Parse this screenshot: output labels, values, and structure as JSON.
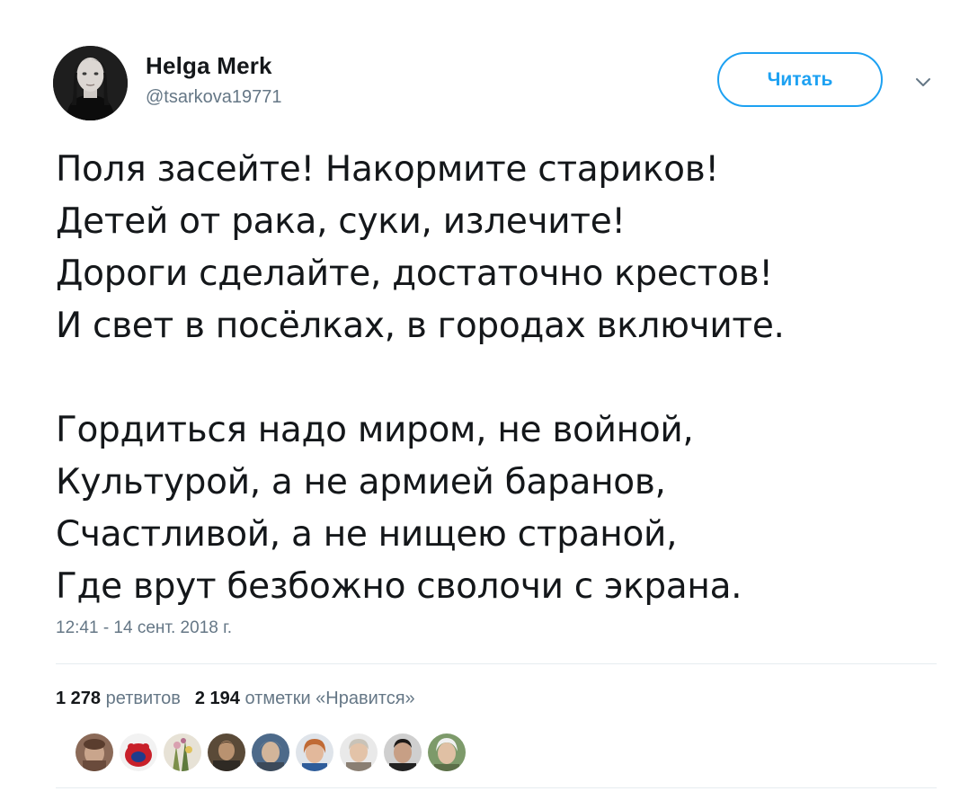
{
  "author": {
    "display_name": "Helga Merk",
    "handle": "@tsarkova19771"
  },
  "follow_button_label": "Читать",
  "menu_icon": "chevron-down-icon",
  "tweet": {
    "stanza1": [
      "Поля засейте! Накормите стариков!",
      "Детей от рака, суки, излечите!",
      "Дороги сделайте, достаточно крестов!",
      "И свет в посёлках, в городах включите."
    ],
    "stanza2": [
      "Гордиться надо миром, не войной,",
      "Культурой, а не армией баранов,",
      "Счастливой, а не нищею страной,",
      "Где врут безбожно сволочи с экрана."
    ],
    "timestamp": "12:41 - 14 сент. 2018 г."
  },
  "stats": {
    "retweets_count": "1 278",
    "retweets_label": "ретвитов",
    "likes_count": "2 194",
    "likes_label": "отметки «Нравится»"
  },
  "liker_avatars": [
    "avatar-1",
    "avatar-2",
    "avatar-3",
    "avatar-4",
    "avatar-5",
    "avatar-6",
    "avatar-7",
    "avatar-8",
    "avatar-9"
  ],
  "colors": {
    "accent": "#1da1f2",
    "text": "#14171a",
    "secondary": "#657786",
    "divider": "#e6ecf0"
  }
}
